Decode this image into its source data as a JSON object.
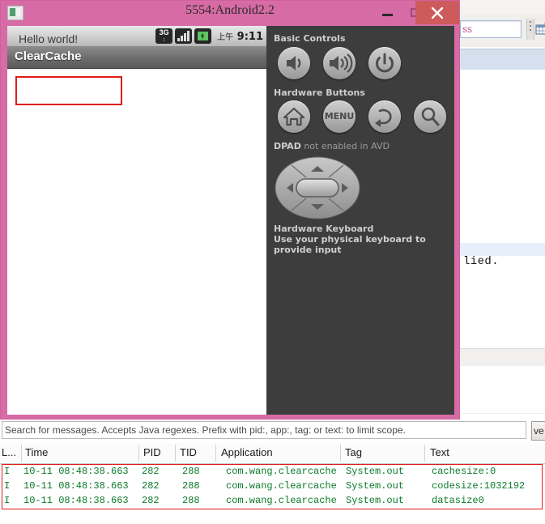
{
  "emulator_window": {
    "title": "5554:Android2.2",
    "icon": "window-app-icon",
    "controls": {
      "minimize": "minimize",
      "maximize": "maximize",
      "close": "close"
    }
  },
  "android_screen": {
    "statusbar": {
      "network_icon": "3g-icon",
      "network_label": "3G",
      "signal_icon": "signal-bars-icon",
      "battery_icon": "battery-charging-icon",
      "clock_period": "上午",
      "clock_time": "9:11"
    },
    "app_title": "ClearCache",
    "content_text": "Hello world!"
  },
  "emulator_panel": {
    "basic_controls_label": "Basic Controls",
    "basic_buttons": [
      {
        "name": "volume-down-button",
        "icon": "volume-down-icon"
      },
      {
        "name": "volume-up-button",
        "icon": "volume-up-icon"
      },
      {
        "name": "power-button",
        "icon": "power-icon"
      }
    ],
    "hardware_buttons_label": "Hardware Buttons",
    "hardware_buttons": [
      {
        "name": "home-button",
        "icon": "home-icon",
        "label": ""
      },
      {
        "name": "menu-button",
        "icon": "menu-icon",
        "label": "MENU"
      },
      {
        "name": "back-button",
        "icon": "back-arrow-icon",
        "label": ""
      },
      {
        "name": "search-button",
        "icon": "search-icon",
        "label": ""
      }
    ],
    "dpad_label": "DPAD",
    "dpad_status": " not enabled in AVD",
    "keyboard_label": "Hardware Keyboard",
    "keyboard_hint": "Use your physical keyboard to provide input"
  },
  "logcat": {
    "search_placeholder": "Search for messages. Accepts Java regexes. Prefix with pid:, app:, tag: or text: to limit scope.",
    "level_button": "ve",
    "columns": [
      "L...",
      "Time",
      "PID",
      "TID",
      "Application",
      "Tag",
      "Text"
    ],
    "rows": [
      {
        "level": "I",
        "time": "10-11 08:48:38.663",
        "pid": "282",
        "tid": "288",
        "application": "com.wang.clearcache",
        "tag": "System.out",
        "text": "cachesize:0"
      },
      {
        "level": "I",
        "time": "10-11 08:48:38.663",
        "pid": "282",
        "tid": "288",
        "application": "com.wang.clearcache",
        "tag": "System.out",
        "text": "codesize:1032192"
      },
      {
        "level": "I",
        "time": "10-11 08:48:38.663",
        "pid": "282",
        "tid": "288",
        "application": "com.wang.clearcache",
        "tag": "System.out",
        "text": "datasize0"
      }
    ],
    "highlight_color": "#e01b1b",
    "row_text_color": "#0b7a28"
  },
  "background_window": {
    "search_value": "ss",
    "mono_text": "lied.",
    "toolbar_icon": "table-add-icon"
  },
  "colors": {
    "window_chrome": "#d66ba5",
    "close_button": "#cd5b5b",
    "panel_background": "#3d3d3d",
    "android_titlebar": "#6f6f6f"
  }
}
